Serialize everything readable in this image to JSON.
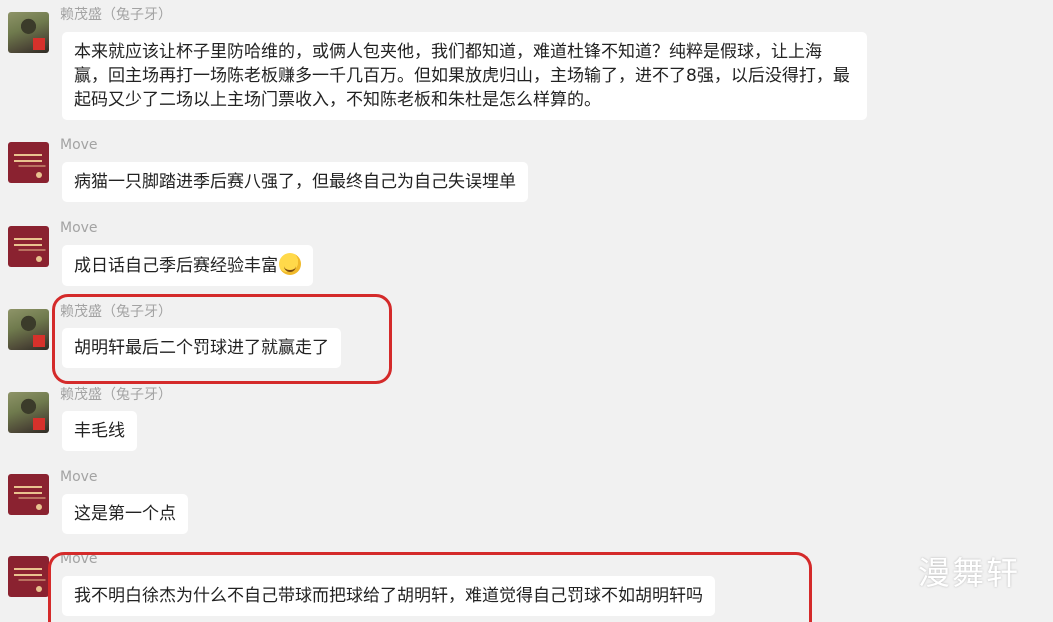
{
  "messages": [
    {
      "sender": "赖茂盛（兔子牙）",
      "text": "本来就应该让杯子里防哈维的，或俩人包夹他，我们都知道，难道杜锋不知道？纯粹是假球，让上海赢，回主场再打一场陈老板赚多一千几百万。但如果放虎归山，主场输了，进不了8强，以后没得打，最起码又少了二场以上主场门票收入，不知陈老板和朱杜是怎么样算的。"
    },
    {
      "sender": "Move",
      "text": "病猫一只脚踏进季后赛八强了，但最终自己为自己失误埋单"
    },
    {
      "sender": "Move",
      "text": "成日话自己季后赛经验丰富",
      "emoji": "laughing-tears-emoji"
    },
    {
      "sender": "赖茂盛（兔子牙）",
      "text": "胡明轩最后二个罚球进了就赢走了"
    },
    {
      "sender": "赖茂盛（兔子牙）",
      "text": "丰毛线"
    },
    {
      "sender": "Move",
      "text": "这是第一个点"
    },
    {
      "sender": "Move",
      "text": "我不明白徐杰为什么不自己带球而把球给了胡明轩，难道觉得自己罚球不如胡明轩吗"
    }
  ],
  "watermark": "漫舞轩",
  "colors": {
    "background": "#f1f1f1",
    "bubble": "#ffffff",
    "highlight": "#d42a2a",
    "sender_name": "#a3a3a3"
  }
}
